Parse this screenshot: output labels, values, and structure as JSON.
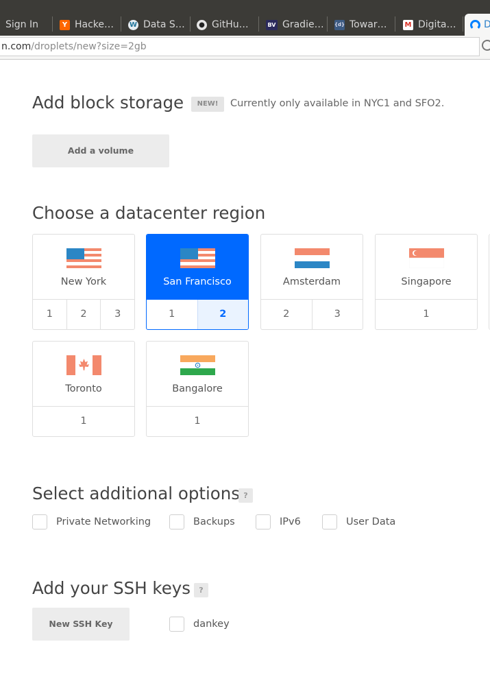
{
  "browser": {
    "tabs": [
      {
        "label": "Sign In",
        "icon": "sign-in-favicon"
      },
      {
        "label": "Hacke…",
        "icon": "hacker-news-favicon",
        "glyph": "Y",
        "color": "#ff6600"
      },
      {
        "label": "Data S…",
        "icon": "wordpress-favicon",
        "glyph": "W",
        "color": "#21759b"
      },
      {
        "label": "GitHu…",
        "icon": "github-favicon",
        "glyph": "●",
        "color": "#222222"
      },
      {
        "label": "Gradie…",
        "icon": "bv-favicon",
        "glyph": "BV",
        "color": "#2b2a5c"
      },
      {
        "label": "Towar…",
        "icon": "towards-favicon",
        "glyph": "{d}",
        "color": "#3c5a82"
      },
      {
        "label": "Digita…",
        "icon": "gmail-favicon",
        "glyph": "M",
        "color": "#d93025"
      },
      {
        "label": "D",
        "icon": "digitalocean-favicon",
        "active": true
      }
    ],
    "url_host": "n.com",
    "url_path": "/droplets/new?size=2gb"
  },
  "block_storage": {
    "heading": "Add block storage",
    "badge": "NEW!",
    "note": "Currently only available in NYC1 and SFO2.",
    "button_label": "Add a volume"
  },
  "datacenter": {
    "heading": "Choose a datacenter region",
    "regions": [
      {
        "name": "New York",
        "flag": "us-flag",
        "numbers": [
          "1",
          "2",
          "3"
        ]
      },
      {
        "name": "San Francisco",
        "flag": "us-flag",
        "numbers": [
          "1",
          "2"
        ],
        "selected": true,
        "selected_number": "2"
      },
      {
        "name": "Amsterdam",
        "flag": "netherlands-flag",
        "numbers": [
          "2",
          "3"
        ]
      },
      {
        "name": "Singapore",
        "flag": "singapore-flag",
        "numbers": [
          "1"
        ]
      },
      {
        "name": "Toronto",
        "flag": "canada-flag",
        "numbers": [
          "1"
        ]
      },
      {
        "name": "Bangalore",
        "flag": "india-flag",
        "numbers": [
          "1"
        ]
      }
    ]
  },
  "options": {
    "heading": "Select additional options",
    "help": "?",
    "items": [
      "Private Networking",
      "Backups",
      "IPv6",
      "User Data"
    ]
  },
  "ssh": {
    "heading": "Add your SSH keys",
    "help": "?",
    "button_label": "New SSH Key",
    "key_name": "dankey"
  },
  "colors": {
    "accent": "#0069ff",
    "flag_red": "#f3896d",
    "flag_blue": "#2b86c5",
    "flag_orange": "#f8a85d",
    "flag_green": "#2ea84c"
  }
}
